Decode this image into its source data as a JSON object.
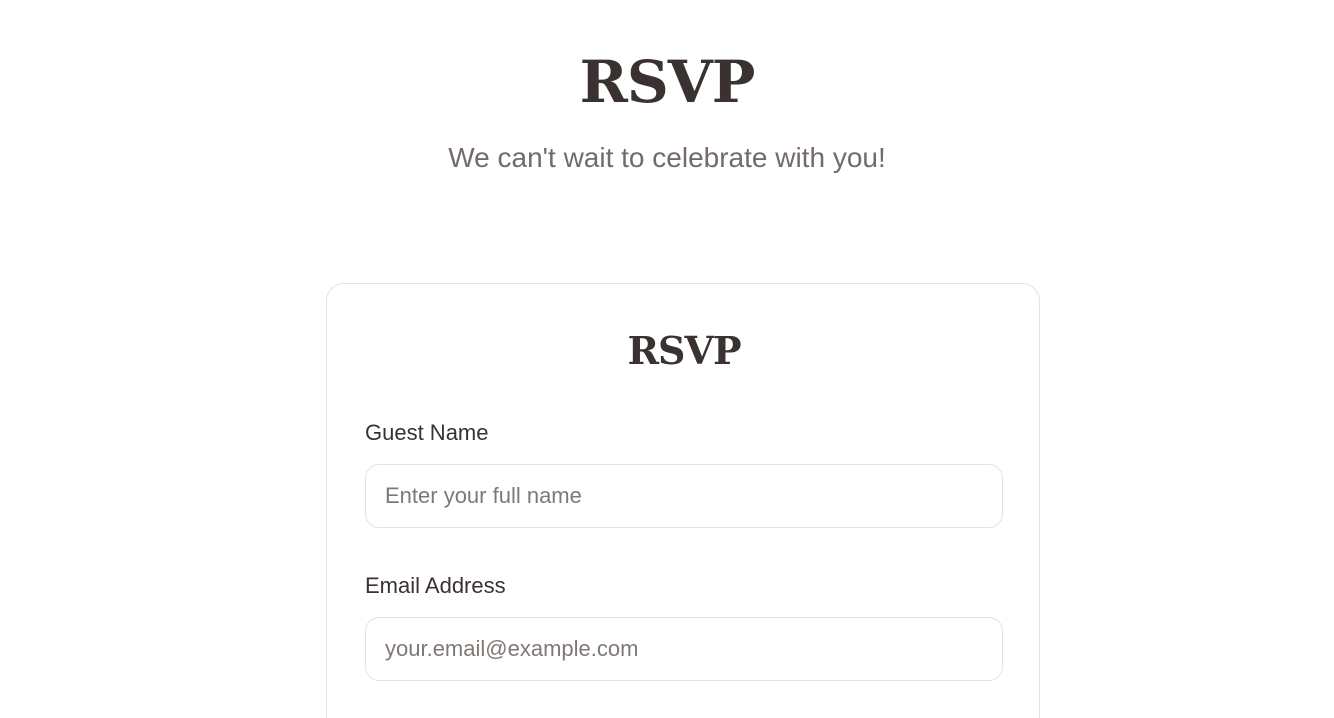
{
  "hero": {
    "title": "RSVP",
    "subtitle": "We can't wait to celebrate with you!"
  },
  "form": {
    "title": "RSVP",
    "fields": [
      {
        "label": "Guest Name",
        "value": "",
        "placeholder": "Enter your full name"
      },
      {
        "label": "Email Address",
        "value": "",
        "placeholder": "your.email@example.com"
      }
    ]
  },
  "colors": {
    "heading": "#3a3230",
    "subtitle": "#736b68",
    "border": "#e4e1df",
    "placeholder": "#807875",
    "background": "#ffffff"
  }
}
